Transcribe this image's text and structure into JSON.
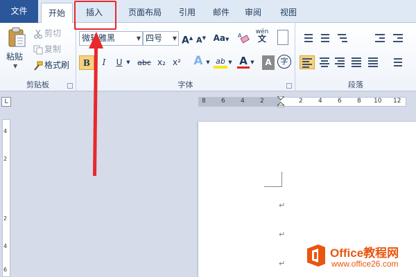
{
  "tabs": {
    "file": "文件",
    "home": "开始",
    "insert": "插入",
    "page_layout": "页面布局",
    "references": "引用",
    "mailings": "邮件",
    "review": "审阅",
    "view": "视图"
  },
  "clipboard": {
    "paste": "粘贴",
    "cut": "剪切",
    "copy": "复制",
    "format_painter": "格式刷",
    "group_label": "剪贴板"
  },
  "font": {
    "font_name": "微软雅黑",
    "font_size": "四号",
    "change_case": "Aa",
    "clear_format_icon": "eraser-icon",
    "phonetic": "wén",
    "bold": "B",
    "italic": "I",
    "underline": "U",
    "strikethrough": "abc",
    "subscript": "x₂",
    "superscript": "x²",
    "text_effect": "A",
    "highlight": "ab",
    "font_color": "A",
    "char_shading": "A",
    "enclose_char": "字",
    "group_label": "字体"
  },
  "paragraph": {
    "group_label": "段落"
  },
  "ruler": {
    "corner": "L",
    "h_numbers": [
      "8",
      "6",
      "4",
      "2",
      "2",
      "4",
      "6",
      "8",
      "10",
      "12"
    ],
    "v_numbers": [
      "4",
      "2",
      "2",
      "4",
      "6"
    ]
  },
  "document": {
    "para_marks": [
      "↵",
      "↵",
      "↵"
    ]
  },
  "watermark": {
    "name": "Office教程网",
    "url": "www.office26.com"
  },
  "colors": {
    "file_tab": "#2b579a",
    "highlight_box": "#e8282d",
    "watermark": "#e8560f"
  }
}
